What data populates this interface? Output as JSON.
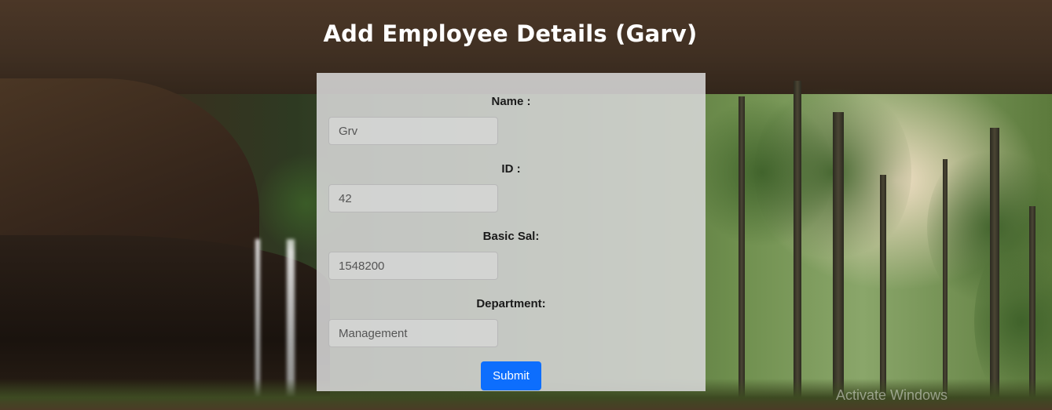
{
  "page": {
    "title": "Add Employee Details (Garv)"
  },
  "form": {
    "fields": [
      {
        "label": "Name :",
        "value": "Grv"
      },
      {
        "label": "ID :",
        "value": "42"
      },
      {
        "label": "Basic Sal:",
        "value": "1548200"
      },
      {
        "label": "Department:",
        "value": "Management"
      }
    ],
    "submit_label": "Submit"
  },
  "watermark": "Activate Windows",
  "colors": {
    "submit_button": "#0d6efd",
    "panel_background": "#d7d7d7",
    "title_text": "#ffffff"
  },
  "icons": {
    "background": "forest-cave-waterfall-photo"
  }
}
